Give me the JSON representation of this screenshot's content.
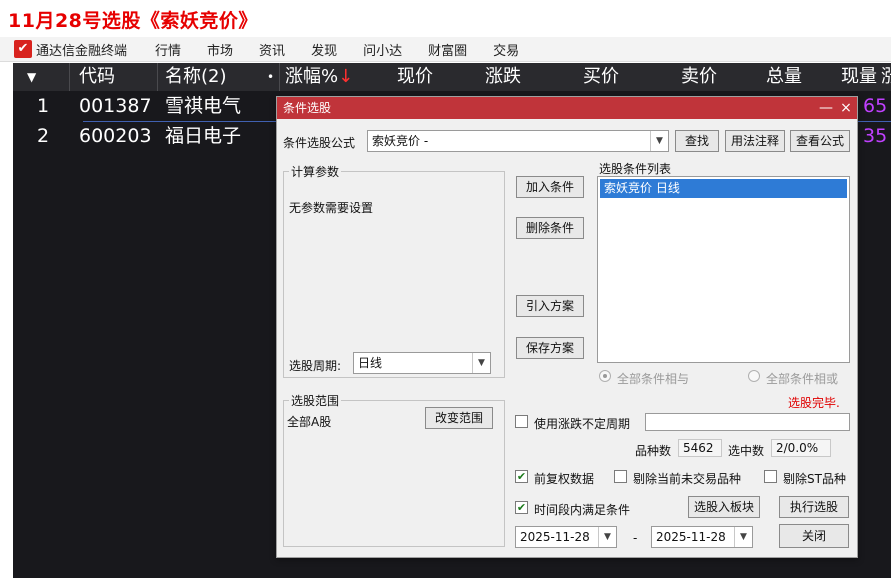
{
  "caption": "11月28号选股《索妖竞价》",
  "menubar": {
    "app_name": "通达信金融终端",
    "logo_icon": "tdx-logo-icon",
    "items": [
      "行情",
      "市场",
      "资讯",
      "发现",
      "问小达",
      "财富圈",
      "交易"
    ]
  },
  "grid": {
    "headers": {
      "sort": "▼",
      "code": "代码",
      "name": "名称(2)",
      "dot": "•",
      "change_pct": "涨幅%",
      "price": "现价",
      "change": "涨跌",
      "bid": "买价",
      "ask": "卖价",
      "volume": "总量",
      "cur_vol": "现量",
      "overflow": "涨"
    },
    "sort_arrow": "↓",
    "rows": [
      {
        "idx": "1",
        "code": "001387",
        "name": "雪祺电气",
        "tail": "65"
      },
      {
        "idx": "2",
        "code": "600203",
        "name": "福日电子",
        "tail": "35"
      }
    ]
  },
  "dialog": {
    "title": "条件选股",
    "minimize": "—",
    "close": "×",
    "formula_label": "条件选股公式",
    "formula_value": "索妖竞价  -",
    "find_btn": "查找",
    "usage_btn": "用法注释",
    "view_btn": "查看公式",
    "params_group": "计算参数",
    "params_text": "无参数需要设置",
    "period_label": "选股周期:",
    "period_value": "日线",
    "add_btn": "加入条件",
    "del_btn": "删除条件",
    "import_btn": "引入方案",
    "save_btn": "保存方案",
    "cond_list_label": "选股条件列表",
    "cond_items": [
      "索妖竞价  日线"
    ],
    "radio_and": "全部条件相与",
    "radio_or": "全部条件相或",
    "status": "选股完毕.",
    "range_group": "选股范围",
    "range_value": "全部A股",
    "change_range_btn": "改变范围",
    "irregular_label": "使用涨跌不定周期",
    "count_label": "品种数",
    "count_value": "5462",
    "selected_label": "选中数",
    "selected_value": "2/0.0%",
    "fq_label": "前复权数据",
    "fq_checked": true,
    "exclude_untraded_label": "剔除当前未交易品种",
    "exclude_untraded_checked": false,
    "exclude_st_label": "剔除ST品种",
    "exclude_st_checked": false,
    "period_cond_label": "时间段内满足条件",
    "period_cond_checked": true,
    "to_block_btn": "选股入板块",
    "execute_btn": "执行选股",
    "date_from": "2025-11-28",
    "date_sep": "-",
    "date_to": "2025-11-28",
    "close_btn": "关闭"
  }
}
